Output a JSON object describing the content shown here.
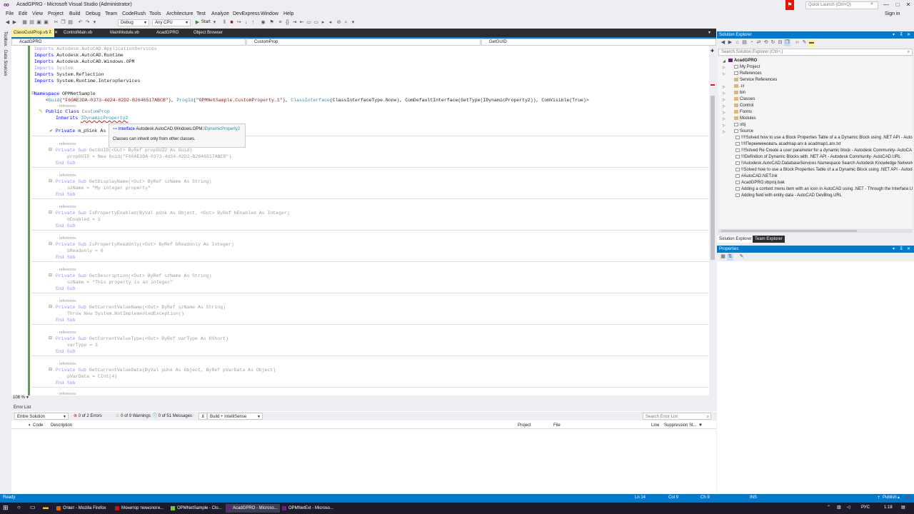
{
  "window": {
    "title": "AcadGPRO - Microsoft Visual Studio (Administrator)",
    "quick_launch_placeholder": "Quick Launch (Ctrl+Q)",
    "sign_in": "Sign in",
    "accent_color": "#007acc"
  },
  "menu": [
    "File",
    "Edit",
    "View",
    "Project",
    "Build",
    "Debug",
    "Team",
    "CodeRush",
    "Tools",
    "Architecture",
    "Test",
    "Analyze",
    "DevExpress",
    "Window",
    "Help"
  ],
  "toolbar": {
    "configuration": "Debug",
    "platform": "Any CPU",
    "start_label": "Start"
  },
  "left_strip": [
    "Toolbox",
    "Data Sources"
  ],
  "doc_tabs": [
    "ClassCustProp.vb",
    "ControlMain.vb",
    "MainModule.vb",
    "AcadGPRO",
    "Object Browser"
  ],
  "nav_bar": {
    "project": "AcadGPRO",
    "type": "CustomProp",
    "member": "GetGUID"
  },
  "code": {
    "imports": [
      {
        "kw": "Imports",
        "ns": "Autodesk.AutoCAD.ApplicationServices",
        "faded": true
      },
      {
        "kw": "Imports",
        "ns": "Autodesk.AutoCAD.Runtime",
        "faded": false
      },
      {
        "kw": "Imports",
        "ns": "Autodesk.AutoCAD.Windows.OPM",
        "faded": false
      },
      {
        "kw": "Imports",
        "ns": "System",
        "faded": true
      },
      {
        "kw": "Imports",
        "ns": "System.Reflection",
        "faded": false
      },
      {
        "kw": "Imports",
        "ns": "System.Runtime.InteropServices",
        "faded": false
      }
    ],
    "namespace_line": "OPMNetSample",
    "attributes_line_guid": "\"F60AE3DA-0373-4d24-82D2-B2646517ABCB\"",
    "attributes_line_progid": "\"OPMNetSample.CustomProperty.1\"",
    "attributes_line_rest": "ClassInterfaceType.None), ComDefaultInterface(GetType(IDynamicProperty2)), ComVisible(True)>",
    "refs_label": "- references",
    "class_name": "CustomProp",
    "inherits_name": "IDynamicProperty2",
    "field_line": "m_pSink As",
    "methods": [
      {
        "sig": "GetGUID(<Out> ByRef propGUID As Guid)",
        "body": "propGUID = New Guid(\"F60AE3DA-0373-4d24-82D2-B2646517ABCB\")"
      },
      {
        "sig": "GetDisplayName(<Out> ByRef szName As String)",
        "body": "szName = \"My integer property\""
      },
      {
        "sig": "IsPropertyEnabled(ByVal pUnk As Object, <Out> ByRef bEnabled As Integer)",
        "body": "bEnabled = 1"
      },
      {
        "sig": "IsPropertyReadOnly(<Out> ByRef bReadonly As Integer)",
        "body": "bReadonly = 0"
      },
      {
        "sig": "GetDescription(<Out> ByRef szName As String)",
        "body": "szName = \"This property is an integer\""
      },
      {
        "sig": "GetCurrentValueName(<Out> ByRef szName As String)",
        "body": "Throw New System.NotImplementedException()"
      },
      {
        "sig": "GetCurrentValueType(<Out> ByRef varType As UShort)",
        "body": "varType = 3"
      },
      {
        "sig": "GetCurrentValueData(ByVal pUnk As Object, ByRef pVarData As Object)",
        "body": "pVarData = CInt(4)"
      }
    ],
    "end_sub": "End Sub",
    "private_sub": "Private Sub"
  },
  "tooltip": {
    "kind": "Interface",
    "namespace": "Autodesk.AutoCAD.Windows.OPM.",
    "name": "IDynamicProperty2",
    "message": "Classes can inherit only from other classes."
  },
  "zoom": "108 %",
  "error_list": {
    "title": "Error List",
    "scope": "Entire Solution",
    "errors": "0 of 2 Errors",
    "warnings": "0 of 9 Warnings",
    "messages": "0 of 51 Messages",
    "build_filter": "Build + IntelliSense",
    "search_placeholder": "Search Error List",
    "columns": [
      "Code",
      "Description",
      "Project",
      "File",
      "Line",
      "Suppression St..."
    ]
  },
  "solution_explorer": {
    "title": "Solution Explorer",
    "search_placeholder": "Search Solution Explorer (Ctrl+;)",
    "project": "AcadGPRO",
    "nodes": [
      {
        "label": "My Project",
        "kind": "wrench",
        "expandable": true
      },
      {
        "label": "References",
        "kind": "ref",
        "expandable": true
      },
      {
        "label": "Service References",
        "kind": "folder",
        "expandable": false
      },
      {
        "label": ".cr",
        "kind": "folder",
        "expandable": true
      },
      {
        "label": "bin",
        "kind": "folder",
        "expandable": true
      },
      {
        "label": "Classes",
        "kind": "folder",
        "expandable": true
      },
      {
        "label": "Control",
        "kind": "folder",
        "expandable": true
      },
      {
        "label": "Forms",
        "kind": "folder",
        "expandable": true
      },
      {
        "label": "Modules",
        "kind": "folder",
        "expandable": true
      },
      {
        "label": "obj",
        "kind": "file",
        "expandable": true
      },
      {
        "label": "Source",
        "kind": "file",
        "expandable": true
      },
      {
        "label": "!!!!Solved how to use a Block Properties Table of a a Dynamic Block using .NET API - Autoc",
        "kind": "file",
        "expandable": false
      },
      {
        "label": "!!!!Переименовать acadmap.arx в acadmap1.arx.txt",
        "kind": "file",
        "expandable": false
      },
      {
        "label": "!!!Solved Re Create a user parameter for a dynamic block - Autodesk Community- AutoCA",
        "kind": "file",
        "expandable": false
      },
      {
        "label": "!!!Definition of Dynamic Blocks with .NET API - Autodesk Community- AutoCAD.URL",
        "kind": "file",
        "expandable": false
      },
      {
        "label": "!!Autodesk.AutoCAD.DatabaseServices Namespace Search Autodesk Knowledge Network.U",
        "kind": "file",
        "expandable": false
      },
      {
        "label": "!!Solved how to use a Block Properties Table of a a Dynamic Block using .NET API - Autode",
        "kind": "file",
        "expandable": false
      },
      {
        "label": "#AutoCAD.NET.lnk",
        "kind": "file",
        "expandable": false
      },
      {
        "label": "AcadGPRO.vbproj.bak",
        "kind": "file",
        "expandable": false
      },
      {
        "label": "Adding a context menu item with an icon in AutoCAD using .NET - Through the Interface.U",
        "kind": "file",
        "expandable": false
      },
      {
        "label": "Adding field with entity data - AutoCAD DevBlog.URL",
        "kind": "file",
        "expandable": false
      }
    ],
    "tabs": [
      "Solution Explorer",
      "Team Explorer"
    ]
  },
  "properties": {
    "title": "Properties"
  },
  "status": {
    "ready": "Ready",
    "line": "Ln 14",
    "col": "Col 9",
    "ch": "Ch 9",
    "mode": "INS",
    "publish": "Publish"
  },
  "taskbar": {
    "tasks": [
      {
        "label": "Ответ - Mozilla Firefox",
        "color": "#e66000"
      },
      {
        "label": "Монитор технологи...",
        "color": "#c01010"
      },
      {
        "label": "OPMNetSample - Clo...",
        "color": "#7ac142"
      },
      {
        "label": "AcadGPRO - Microso...",
        "color": "#68217a"
      },
      {
        "label": "OPMNetExt - Microso...",
        "color": "#68217a"
      }
    ],
    "lang": "РУС",
    "time": "1:18"
  }
}
